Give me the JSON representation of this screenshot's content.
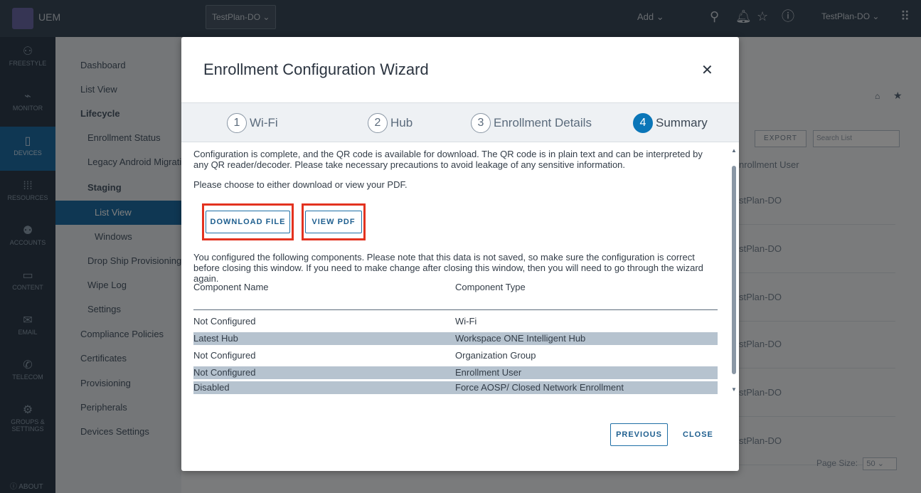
{
  "topbar": {
    "app_name": "UEM",
    "org_selector": "TestPlan-DO ⌄",
    "add_label": "Add ⌄",
    "user_label": "TestPlan-DO ⌄"
  },
  "sidebar": {
    "items": [
      {
        "label": "FREESTYLE",
        "icon": "freestyle-icon"
      },
      {
        "label": "MONITOR",
        "icon": "monitor-icon"
      },
      {
        "label": "DEVICES",
        "icon": "devices-icon"
      },
      {
        "label": "RESOURCES",
        "icon": "resources-icon"
      },
      {
        "label": "ACCOUNTS",
        "icon": "accounts-icon"
      },
      {
        "label": "CONTENT",
        "icon": "content-icon"
      },
      {
        "label": "EMAIL",
        "icon": "email-icon"
      },
      {
        "label": "TELECOM",
        "icon": "telecom-icon"
      },
      {
        "label": "GROUPS & SETTINGS",
        "icon": "gear-icon"
      }
    ],
    "about": "ABOUT"
  },
  "subnav": {
    "items": [
      "Dashboard",
      "List View",
      "Lifecycle",
      "Enrollment Status",
      "Legacy Android Migration",
      "Staging",
      "List View",
      "Windows",
      "Drop Ship Provisioning",
      "Wipe Log",
      "Settings",
      "Compliance Policies",
      "Certificates",
      "Provisioning",
      "Peripherals",
      "Devices Settings"
    ]
  },
  "background": {
    "export_label": "EXPORT",
    "search_placeholder": "Search List",
    "column_header": "nrollment User",
    "rows": [
      "stPlan-DO",
      "stPlan-DO",
      "stPlan-DO",
      "stPlan-DO",
      "stPlan-DO",
      "stPlan-DO"
    ],
    "page_size_label": "Page Size:",
    "page_size_value": "50"
  },
  "modal": {
    "title": "Enrollment Configuration Wizard",
    "close_glyph": "✕",
    "steps": [
      {
        "num": "1",
        "label": "Wi-Fi"
      },
      {
        "num": "2",
        "label": "Hub"
      },
      {
        "num": "3",
        "label": "Enrollment Details"
      },
      {
        "num": "4",
        "label": "Summary"
      }
    ],
    "intro_text": "Configuration is complete, and the QR code is available for download. The QR code is in plain text and can be interpreted by any QR reader/decoder. Please take necessary precautions to avoid leakage of any sensitive information.",
    "choose_text": "Please choose to either download or view your PDF.",
    "download_label": "DOWNLOAD FILE",
    "view_pdf_label": "VIEW PDF",
    "components_text": "You configured the following components. Please note that this data is not saved, so make sure the configuration is correct before closing this window. If you need to make change after closing this window, then you will need to go through the wizard again.",
    "table": {
      "headers": [
        "Component Name",
        "Component Type"
      ],
      "rows": [
        [
          "Not Configured",
          "Wi-Fi"
        ],
        [
          "Latest Hub",
          "Workspace ONE Intelligent Hub"
        ],
        [
          "Not Configured",
          "Organization Group"
        ],
        [
          "Not Configured",
          "Enrollment User"
        ],
        [
          "Disabled",
          "Force AOSP/ Closed Network Enrollment"
        ]
      ]
    },
    "previous_label": "PREVIOUS",
    "close_label": "CLOSE"
  },
  "colors": {
    "accent": "#0b76b8",
    "highlight": "#e3321f",
    "shaded_row": "#b6c3cf"
  }
}
